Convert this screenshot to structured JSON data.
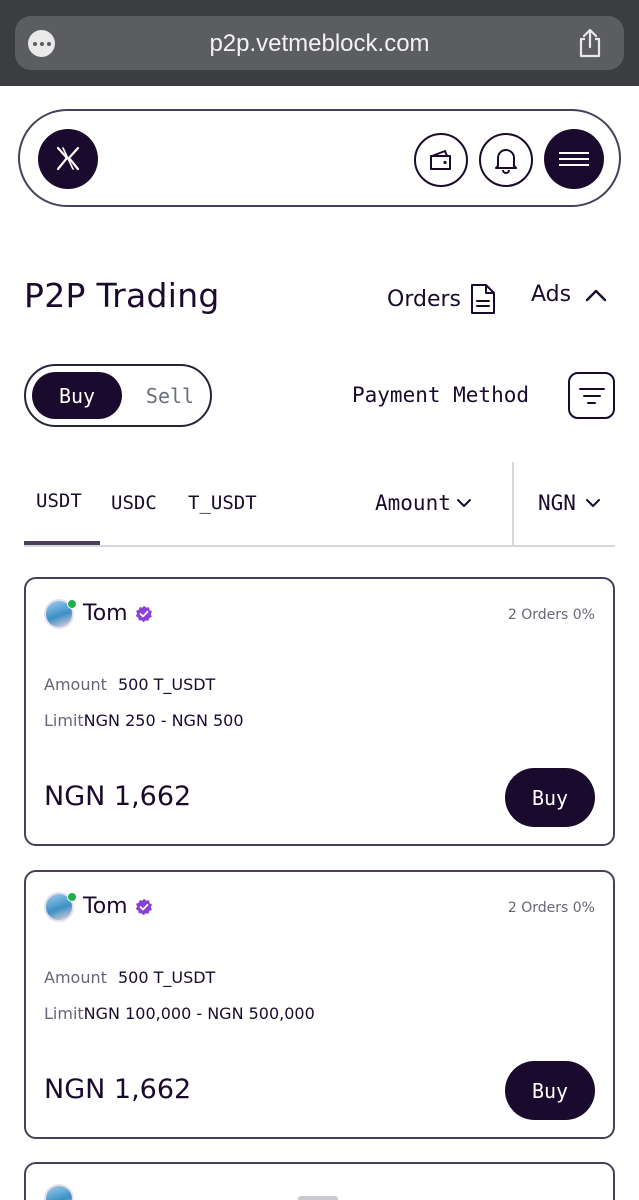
{
  "browser": {
    "url": "p2p.vetmeblock.com",
    "icons": [
      "more-dots-icon",
      "share-icon"
    ]
  },
  "header": {
    "icons": [
      "logo-icon",
      "wallet-icon",
      "bell-icon",
      "menu-icon"
    ]
  },
  "page": {
    "title": "P2P Trading",
    "orders_label": "Orders",
    "ads_label": "Ads"
  },
  "trade_toggle": {
    "buy_label": "Buy",
    "sell_label": "Sell",
    "active": "Buy"
  },
  "filters": {
    "payment_method_label": "Payment Method",
    "amount_label": "Amount",
    "currency_label": "NGN"
  },
  "tabs": [
    {
      "label": "USDT",
      "active": true
    },
    {
      "label": "USDC",
      "active": false
    },
    {
      "label": "T_USDT",
      "active": false
    }
  ],
  "offers": [
    {
      "trader": "Tom",
      "orders_stat": "2 Orders 0%",
      "amount_label": "Amount",
      "amount_value": "500 T_USDT",
      "limit_label": "Limit",
      "limit_value": "NGN 250 - NGN 500",
      "price": "NGN 1,662",
      "action_label": "Buy"
    },
    {
      "trader": "Tom",
      "orders_stat": "2 Orders 0%",
      "amount_label": "Amount",
      "amount_value": "500 T_USDT",
      "limit_label": "Limit",
      "limit_value": "NGN 100,000 - NGN 500,000",
      "price": "NGN 1,662",
      "action_label": "Buy"
    }
  ],
  "colors": {
    "brand_dark": "#1a0b2e",
    "verified": "#8b3fd9",
    "online": "#1fb04c",
    "muted_text": "#6a6478"
  }
}
